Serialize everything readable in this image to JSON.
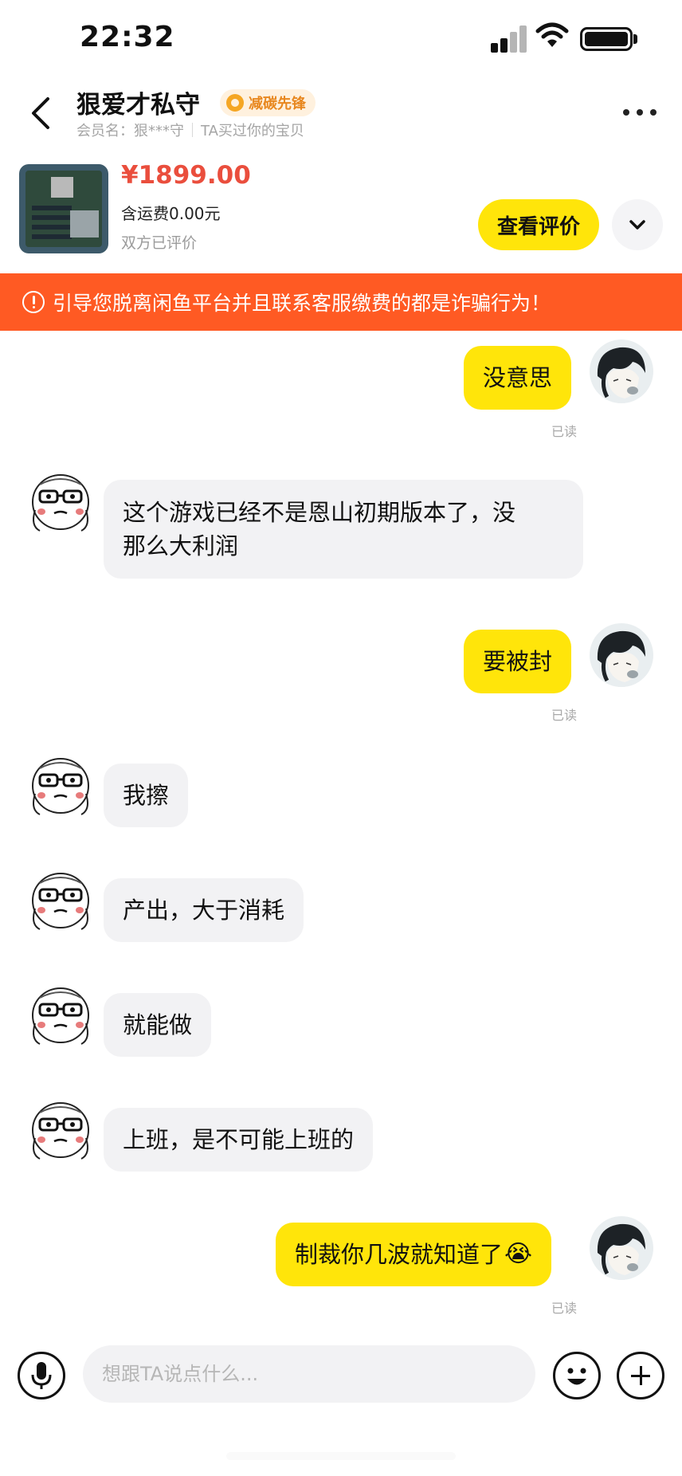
{
  "status_bar": {
    "time": "22:32"
  },
  "header": {
    "contact_name": "狠爱才私守",
    "badge": "减碳先锋",
    "member_name": "会员名：狠***守",
    "relation": "TA买过你的宝贝"
  },
  "product": {
    "price": "¥1899.00",
    "shipping": "含运费0.00元",
    "review_state": "双方已评价",
    "view_review_label": "查看评价"
  },
  "warning": {
    "text": "引导您脱离闲鱼平台并且联系客服缴费的都是诈骗行为！"
  },
  "messages": [
    {
      "sender": "self",
      "text": "没意思",
      "status": "已读"
    },
    {
      "sender": "other",
      "text_line1": "这个游戏已经不是恩山初期版本了，没",
      "text_line2": "那么大利润"
    },
    {
      "sender": "self",
      "text": "要被封",
      "status": "已读"
    },
    {
      "sender": "other",
      "text": "我擦"
    },
    {
      "sender": "other",
      "text": "产出，大于消耗"
    },
    {
      "sender": "other",
      "text": "就能做"
    },
    {
      "sender": "other",
      "text": "上班，是不可能上班的"
    },
    {
      "sender": "self",
      "text": "制裁你几波就知道了",
      "emoji": "😭",
      "status": "已读"
    }
  ],
  "input": {
    "placeholder": "想跟TA说点什么..."
  }
}
